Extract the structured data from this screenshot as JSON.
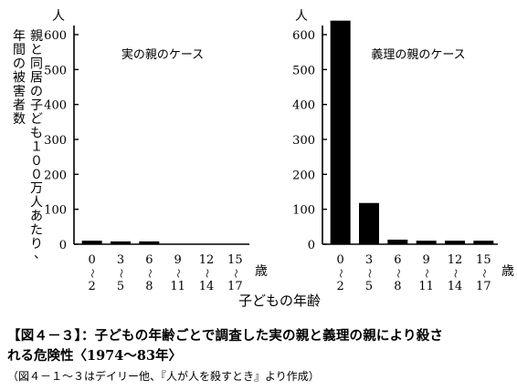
{
  "chart_data": [
    {
      "type": "bar",
      "title": "実の親のケース",
      "ylabel": "親と同居の子ども１００万人あたり、年間の被害者数",
      "yunit": "人",
      "xunit": "歳",
      "ylim": [
        0,
        600
      ],
      "yticks": [
        0,
        100,
        200,
        300,
        400,
        500,
        600
      ],
      "categories": [
        {
          "top": "0",
          "mid": "～",
          "bottom": "2"
        },
        {
          "top": "3",
          "mid": "～",
          "bottom": "5"
        },
        {
          "top": "6",
          "mid": "～",
          "bottom": "8"
        },
        {
          "top": "9",
          "mid": "～",
          "bottom": "11"
        },
        {
          "top": "12",
          "mid": "～",
          "bottom": "14"
        },
        {
          "top": "15",
          "mid": "～",
          "bottom": "17"
        }
      ],
      "values": [
        10,
        8,
        8,
        0,
        0,
        0
      ]
    },
    {
      "type": "bar",
      "title": "義理の親のケース",
      "yunit": "人",
      "xunit": "歳",
      "ylim": [
        0,
        600
      ],
      "yticks": [
        0,
        100,
        200,
        300,
        400,
        500,
        600
      ],
      "categories": [
        {
          "top": "0",
          "mid": "～",
          "bottom": "2"
        },
        {
          "top": "3",
          "mid": "～",
          "bottom": "5"
        },
        {
          "top": "6",
          "mid": "～",
          "bottom": "8"
        },
        {
          "top": "9",
          "mid": "～",
          "bottom": "11"
        },
        {
          "top": "12",
          "mid": "～",
          "bottom": "14"
        },
        {
          "top": "15",
          "mid": "～",
          "bottom": "17"
        }
      ],
      "values": [
        640,
        118,
        13,
        10,
        10,
        10
      ]
    }
  ],
  "xlabel": "子どもの年齢",
  "caption": {
    "line1": "【図４－３】：子どもの年齢ごとで調査した実の親と義理の親により殺さ",
    "line2": "れる危険性〈1974～83年〉",
    "line3": "（図４－１～３はデイリー他、『人が人を殺すとき』より作成）"
  }
}
